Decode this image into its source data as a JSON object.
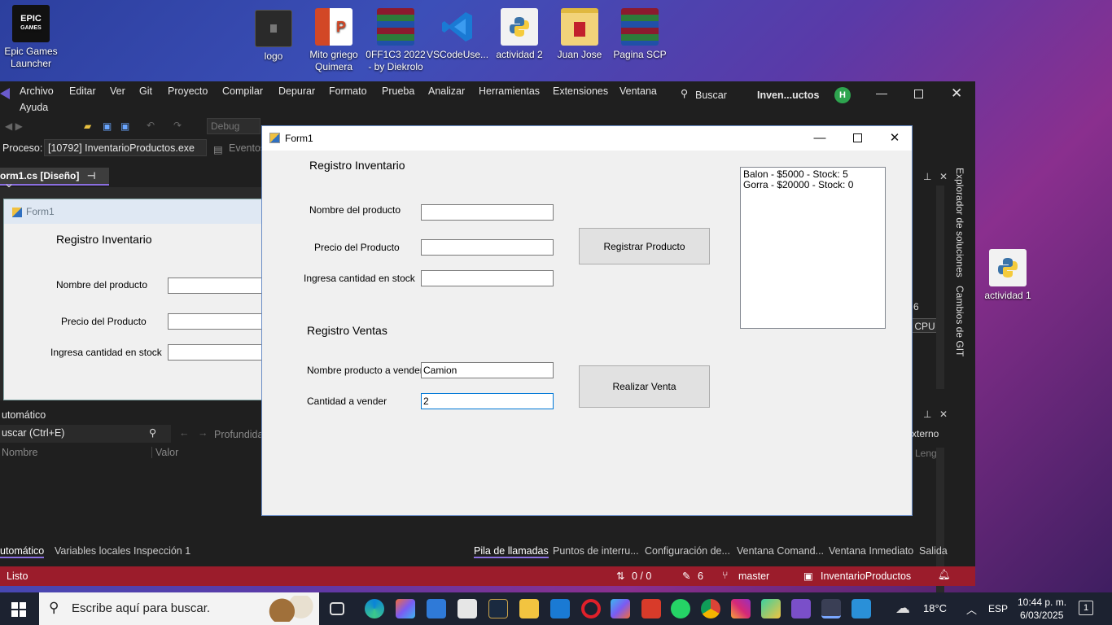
{
  "desktop_icons": [
    {
      "label": "Epic Games Launcher",
      "icon": "epic-games-icon",
      "badge": "EPIC\nGAMES",
      "color": "#111111"
    },
    {
      "label": "logo",
      "icon": "image-file-icon",
      "badge": "",
      "color": "#2a2a2a"
    },
    {
      "label": "Mito griego Quimera",
      "icon": "powerpoint-icon",
      "badge": "P",
      "color": "#d24726"
    },
    {
      "label": "0FF1C3 2022 - by Diekrolo",
      "icon": "winrar-icon",
      "badge": "",
      "color": "#8b1a2e"
    },
    {
      "label": "VSCodeUse...",
      "icon": "vscode-icon",
      "badge": "",
      "color": "#1a7ad4"
    },
    {
      "label": "actividad 2",
      "icon": "python-file-icon",
      "badge": "",
      "color": "#f2f2f2"
    },
    {
      "label": "Juan Jose",
      "icon": "folder-icon",
      "badge": "",
      "color": "#f2d37a"
    },
    {
      "label": "Pagina SCP",
      "icon": "winrar-icon",
      "badge": "",
      "color": "#8b1a2e"
    },
    {
      "label": "actividad 1",
      "icon": "python-file-icon",
      "badge": "",
      "color": "#f2f2f2"
    }
  ],
  "vs": {
    "menu": [
      "Archivo",
      "Editar",
      "Ver",
      "Git",
      "Proyecto",
      "Compilar",
      "Depurar",
      "Formato",
      "Prueba",
      "Analizar",
      "Herramientas",
      "Extensiones",
      "Ventana"
    ],
    "menu_ayuda": "Ayuda",
    "search": "Buscar",
    "project_name": "Inven...uctos",
    "toolbar_config": "Debug",
    "process_label": "Proceso:",
    "process_value": "[10792] InventarioProductos.exe",
    "events": "Eventos",
    "doc_tab": "orm1.cs [Diseño]",
    "right_panel_tabs": [
      "Explorador de soluciones",
      "Cambios de GIT"
    ],
    "right_extra": [
      "6",
      "CPU",
      "xterno",
      "Leng"
    ],
    "designer": {
      "form_title": "Form1",
      "heading": "Registro Inventario",
      "labels": [
        "Nombre del producto",
        "Precio del Producto",
        "Ingresa cantidad en stock"
      ]
    },
    "autos": {
      "title": "utomático",
      "search_placeholder": "uscar (Ctrl+E)",
      "depth": "Profundida",
      "columns": [
        "Nombre",
        "Valor"
      ]
    },
    "bottom_tabs_left": [
      "utomático",
      "Variables locales",
      "Inspección 1"
    ],
    "bottom_tabs_right": [
      "Pila de llamadas",
      "Puntos de interru...",
      "Configuración de...",
      "Ventana Comand...",
      "Ventana Inmediato",
      "Salida"
    ],
    "status": {
      "left": "Listo",
      "changes": "0 / 0",
      "pencil": "6",
      "branch": "master",
      "project": "InventarioProductos"
    }
  },
  "form1": {
    "title": "Form1",
    "inv_heading": "Registro Inventario",
    "lbl_nombre": "Nombre del producto",
    "lbl_precio": "Precio del Producto",
    "lbl_stock": "Ingresa cantidad en stock",
    "btn_registrar": "Registrar Producto",
    "ventas_heading": "Registro Ventas",
    "lbl_vender": "Nombre producto a vender",
    "lbl_cantidad": "Cantidad a vender",
    "val_nombre": "",
    "val_precio": "",
    "val_stock": "",
    "val_vender": "Camion",
    "val_cantidad": "2",
    "btn_venta": "Realizar Venta",
    "list_items": [
      "Balon - $5000 - Stock: 5",
      "Gorra - $20000 - Stock: 0"
    ]
  },
  "taskbar": {
    "search_placeholder": "Escribe aquí para buscar.",
    "weather": "18°C",
    "lang": "ESP",
    "time": "10:44 p. m.",
    "date": "6/03/2025",
    "notifications": "1"
  },
  "colors": {
    "vs_bg": "#1f1f1f",
    "status_bar": "#9b1c2b",
    "accent": "#8a6ee0"
  }
}
